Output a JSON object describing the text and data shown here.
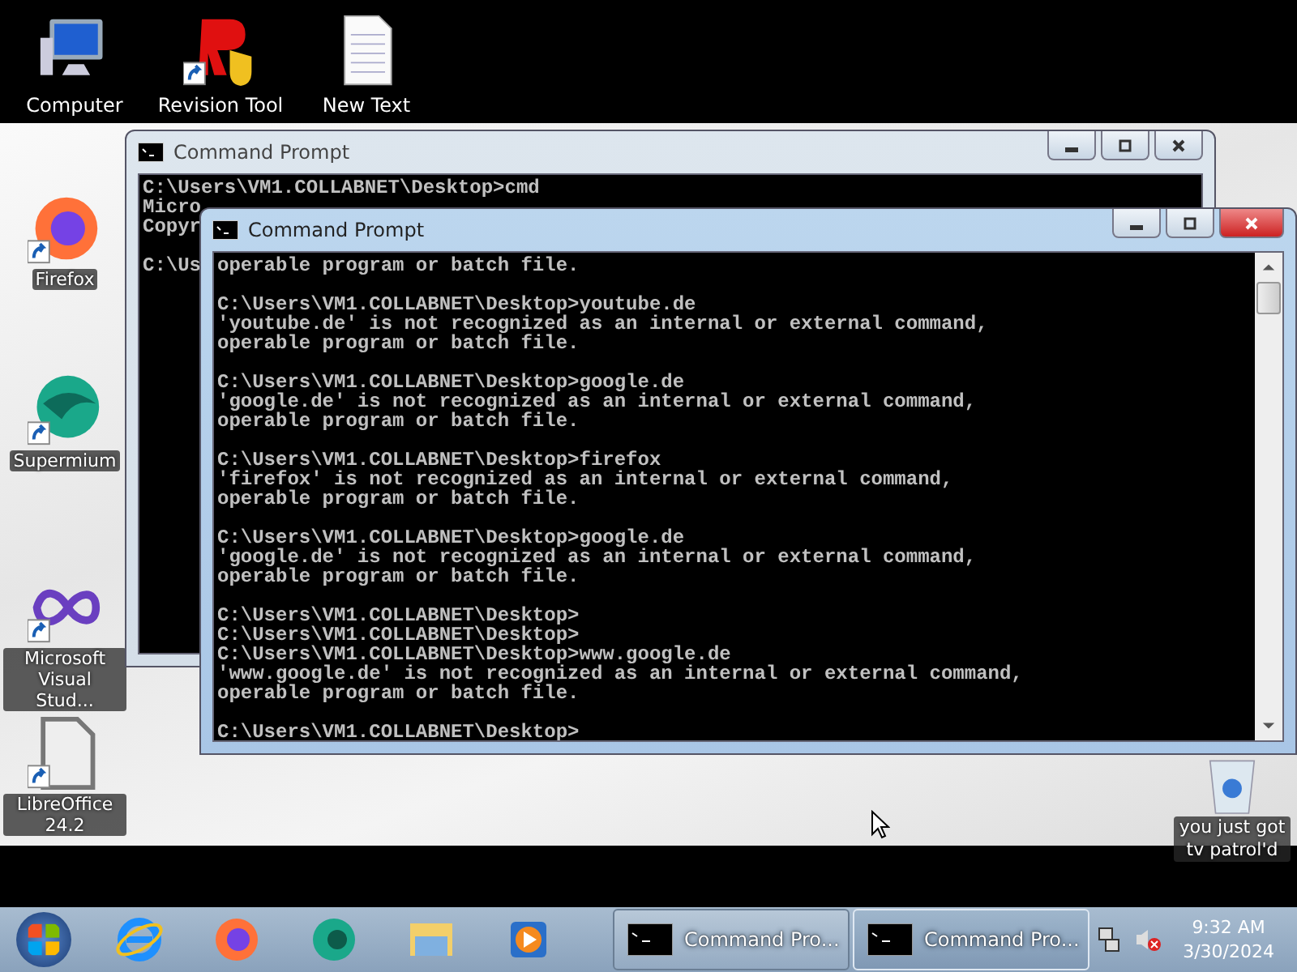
{
  "desktop": {
    "top_icons": [
      {
        "label": "Computer",
        "kind": "computer",
        "shortcut": false
      },
      {
        "label": "Revision Tool",
        "kind": "revision",
        "shortcut": true
      },
      {
        "label": "New Text",
        "kind": "textfile",
        "shortcut": false
      }
    ],
    "side_icons": [
      {
        "label": "Firefox",
        "kind": "firefox",
        "shortcut": true
      },
      {
        "label": "Supermium",
        "kind": "supermium",
        "shortcut": true
      },
      {
        "label": "Microsoft Visual Stud...",
        "kind": "visualstudio",
        "shortcut": true
      },
      {
        "label": "LibreOffice 24.2",
        "kind": "libreoffice",
        "shortcut": true
      }
    ],
    "recycle_bin": {
      "label": "you just got tv patrol'd"
    }
  },
  "windows": [
    {
      "title": "Command Prompt",
      "active": false,
      "blocks": [
        [
          "C:\\Users\\VM1.COLLABNET\\Desktop>cmd",
          "Micro",
          "Copyr"
        ],
        [
          "C:\\Us"
        ]
      ]
    },
    {
      "title": "Command Prompt",
      "active": true,
      "blocks": [
        [
          "operable program or batch file."
        ],
        [
          "C:\\Users\\VM1.COLLABNET\\Desktop>youtube.de",
          "'youtube.de' is not recognized as an internal or external command,",
          "operable program or batch file."
        ],
        [
          "C:\\Users\\VM1.COLLABNET\\Desktop>google.de",
          "'google.de' is not recognized as an internal or external command,",
          "operable program or batch file."
        ],
        [
          "C:\\Users\\VM1.COLLABNET\\Desktop>firefox",
          "'firefox' is not recognized as an internal or external command,",
          "operable program or batch file."
        ],
        [
          "C:\\Users\\VM1.COLLABNET\\Desktop>google.de",
          "'google.de' is not recognized as an internal or external command,",
          "operable program or batch file."
        ],
        [
          "C:\\Users\\VM1.COLLABNET\\Desktop>",
          "C:\\Users\\VM1.COLLABNET\\Desktop>",
          "C:\\Users\\VM1.COLLABNET\\Desktop>www.google.de",
          "'www.google.de' is not recognized as an internal or external command,",
          "operable program or batch file."
        ],
        [
          "C:\\Users\\VM1.COLLABNET\\Desktop>"
        ]
      ]
    }
  ],
  "taskbar": {
    "pinned": [
      {
        "kind": "ie"
      },
      {
        "kind": "firefox"
      },
      {
        "kind": "supermium"
      },
      {
        "kind": "explorer"
      },
      {
        "kind": "media"
      }
    ],
    "tasks": [
      {
        "label": "Command Pro...",
        "selected": false
      },
      {
        "label": "Command Pro...",
        "selected": true
      }
    ],
    "time": "9:32 AM",
    "date": "3/30/2024"
  }
}
